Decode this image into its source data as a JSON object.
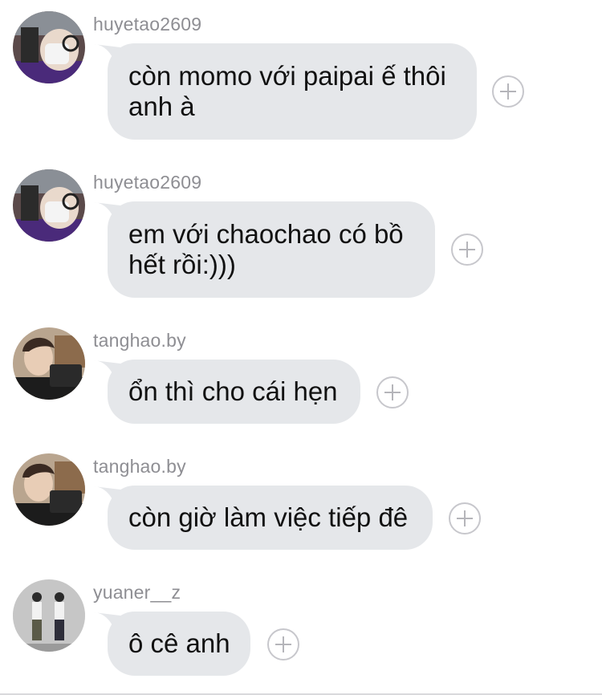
{
  "messages": [
    {
      "username": "huyetao2609",
      "avatar_icon": "user-avatar-huyetao2609",
      "text": "còn momo với paipai ế thôi\nanh à"
    },
    {
      "username": "huyetao2609",
      "avatar_icon": "user-avatar-huyetao2609",
      "text": "em với chaochao có bồ\nhết rồi:)))"
    },
    {
      "username": "tanghao.by",
      "avatar_icon": "user-avatar-tanghao",
      "text": "ổn thì cho cái hẹn"
    },
    {
      "username": "tanghao.by",
      "avatar_icon": "user-avatar-tanghao",
      "text": "còn giờ làm việc tiếp đê"
    },
    {
      "username": "yuaner__z",
      "avatar_icon": "user-avatar-yuaner",
      "text": "ô cê anh"
    }
  ],
  "colors": {
    "bubble_bg": "#e5e7ea",
    "username_text": "#8e8e93",
    "react_icon": "#c7c7cc"
  }
}
